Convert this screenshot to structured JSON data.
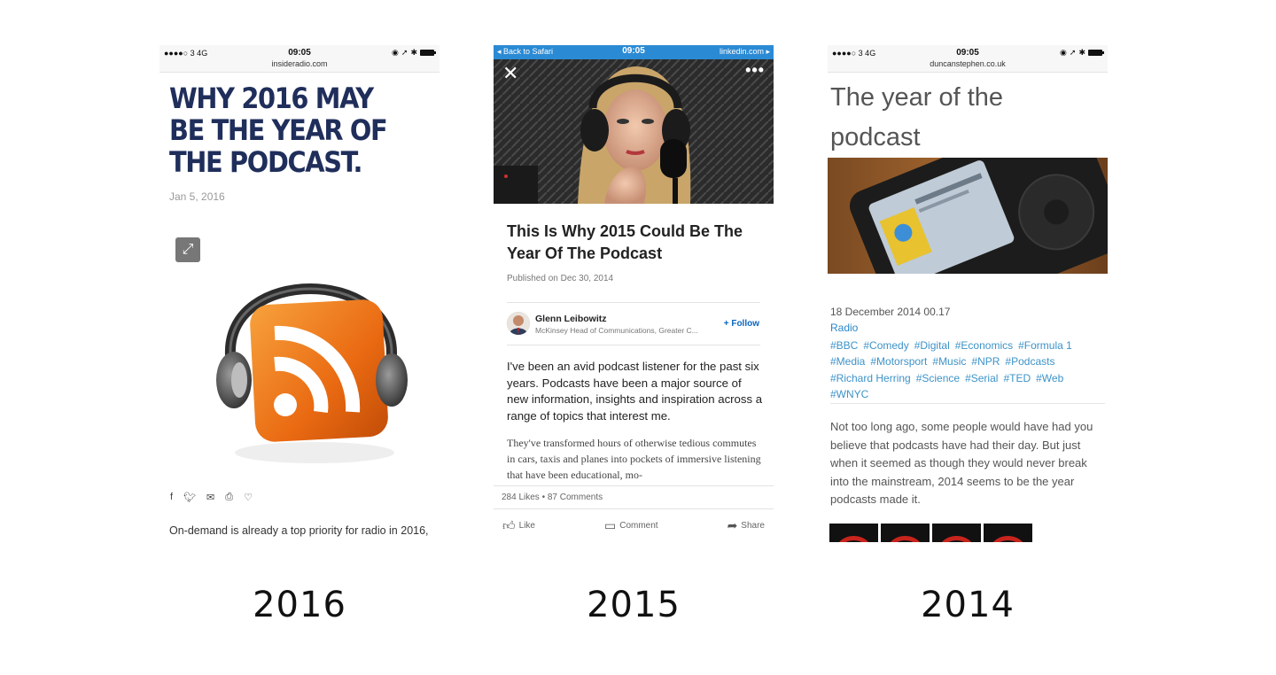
{
  "panels": [
    {
      "year": "2016",
      "status": {
        "carrier": "●●●●○ 3  4G",
        "time": "09:05",
        "url": "insideradio.com"
      },
      "title": "WHY 2016 MAY BE THE YEAR OF THE PODCAST.",
      "date": "Jan 5, 2016",
      "share_icons": [
        "facebook-icon",
        "twitter-icon",
        "email-icon",
        "print-icon",
        "heart-icon"
      ],
      "body": "On-demand is already a top priority for radio in 2016,"
    },
    {
      "year": "2015",
      "topbar": {
        "back": "◂ Back to Safari",
        "time": "09:05",
        "host": "linkedin.com ▸"
      },
      "title": "This Is Why 2015 Could Be The Year Of The Podcast",
      "published": "Published on Dec 30, 2014",
      "author": {
        "name": "Glenn Leibowitz",
        "role": "McKinsey Head of Communications, Greater C...",
        "follow": "+ Follow"
      },
      "lead": "I've been an avid podcast listener for the past six years. Podcasts have been a major source of new information, insights and inspiration across a range of topics that interest me.",
      "body": "They've transformed hours of otherwise tedious commutes in cars, taxis and planes into pockets of immersive listening that have been educational, mo-",
      "stats": "284 Likes • 87 Comments",
      "actions": {
        "like": "Like",
        "comment": "Comment",
        "share": "Share"
      }
    },
    {
      "year": "2014",
      "status": {
        "carrier": "●●●●○ 3  4G",
        "time": "09:05",
        "url": "duncanstephen.co.uk"
      },
      "title": "The year of the podcast",
      "date": "18 December 2014 00.17",
      "category": "Radio",
      "tags": [
        "#BBC",
        "#Comedy",
        "#Digital",
        "#Economics",
        "#Formula 1",
        "#Media",
        "#Motorsport",
        "#Music",
        "#NPR",
        "#Podcasts",
        "#Richard Herring",
        "#Science",
        "#Serial",
        "#TED",
        "#Web",
        "#WNYC"
      ],
      "body": "Not too long ago, some people would have had you believe that podcasts have had their day. But just when it seemed as though they would never break into the mainstream, 2014 seems to be the year podcasts made it."
    }
  ],
  "colors": {
    "insideradio_title": "#1f2e5a",
    "linkedin_blue": "#2b8ad4",
    "tag_blue": "#3d93c8"
  }
}
